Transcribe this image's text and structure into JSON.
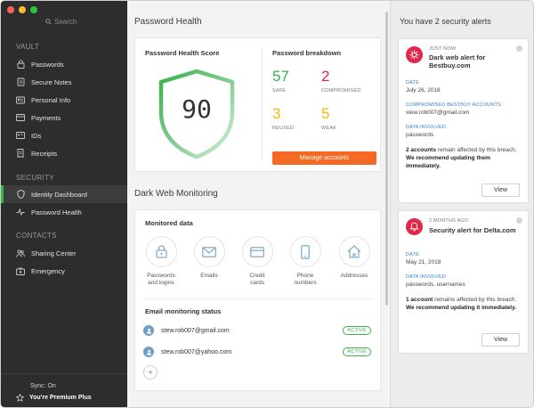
{
  "sidebar": {
    "search_placeholder": "Search",
    "vault_label": "VAULT",
    "vault_items": [
      {
        "label": "Passwords",
        "icon": "lock-icon"
      },
      {
        "label": "Secure Notes",
        "icon": "note-icon"
      },
      {
        "label": "Personal Info",
        "icon": "id-card-icon"
      },
      {
        "label": "Payments",
        "icon": "credit-card-icon"
      },
      {
        "label": "IDs",
        "icon": "id-icon"
      },
      {
        "label": "Receipts",
        "icon": "receipt-icon"
      }
    ],
    "security_label": "SECURITY",
    "security_items": [
      {
        "label": "Identity Dashboard",
        "icon": "shield-icon",
        "active": true
      },
      {
        "label": "Password Health",
        "icon": "pulse-icon",
        "active": false
      }
    ],
    "contacts_label": "CONTACTS",
    "contacts_items": [
      {
        "label": "Sharing Center",
        "icon": "people-icon"
      },
      {
        "label": "Emergency",
        "icon": "emergency-icon"
      }
    ],
    "sync_status": "Sync: On",
    "plan": "You're Premium Plus"
  },
  "main": {
    "password_health_title": "Password Health",
    "score_label": "Password Health Score",
    "score": "90",
    "breakdown_label": "Password breakdown",
    "stats": [
      {
        "value": "57",
        "label": "SAFE",
        "color": "#37b24d"
      },
      {
        "value": "2",
        "label": "COMPROMISED",
        "color": "#e0284a"
      },
      {
        "value": "3",
        "label": "REUSED",
        "color": "#f2b705"
      },
      {
        "value": "5",
        "label": "WEAK",
        "color": "#f2b705"
      }
    ],
    "manage_button": "Manage accounts",
    "dark_web_title": "Dark Web Monitoring",
    "monitored_label": "Monitored data",
    "monitored_items": [
      {
        "label_line1": "Passwords",
        "label_line2": "and logins",
        "icon": "lock-icon"
      },
      {
        "label_line1": "Emails",
        "label_line2": "",
        "icon": "mail-icon"
      },
      {
        "label_line1": "Credit",
        "label_line2": "cards",
        "icon": "credit-card-icon"
      },
      {
        "label_line1": "Phone",
        "label_line2": "numbers",
        "icon": "phone-icon"
      },
      {
        "label_line1": "Addresses",
        "label_line2": "",
        "icon": "home-icon"
      }
    ],
    "email_status_label": "Email monitoring status",
    "emails": [
      {
        "address": "stew.rob007@gmail.com",
        "status": "ACTIVE"
      },
      {
        "address": "stew.rob007@yahoo.com",
        "status": "ACTIVE"
      }
    ],
    "add_button": "+"
  },
  "alerts": {
    "title": "You have 2 security alerts",
    "items": [
      {
        "time": "JUST NOW",
        "heading": "Dark web alert for Bestbuy.com",
        "icon": "virus-icon",
        "date_label": "DATE",
        "date": "July 26, 2018",
        "accounts_label": "COMPROMISED BESTBUY ACCOUNTS",
        "accounts": "stew.rob007@gmail.com",
        "involved_label": "DATA INVOLVED",
        "involved": "passwords",
        "msg_bold1": "2 accounts",
        "msg_rest": " remain affected by this breach. ",
        "msg_bold2": "We recommend updating them immediately.",
        "view_button": "View"
      },
      {
        "time": "2 MONTHS AGO",
        "heading": "Security alert for Delta.com",
        "icon": "bell-icon",
        "date_label": "DATE",
        "date": "May 21, 2018",
        "involved_label": "DATA INVOLVED",
        "involved": "passwords, usernames",
        "msg_bold1": "1 account",
        "msg_rest": " remains affected by this breach. ",
        "msg_bold2": "We recommend updating it immediately.",
        "view_button": "View"
      }
    ]
  }
}
